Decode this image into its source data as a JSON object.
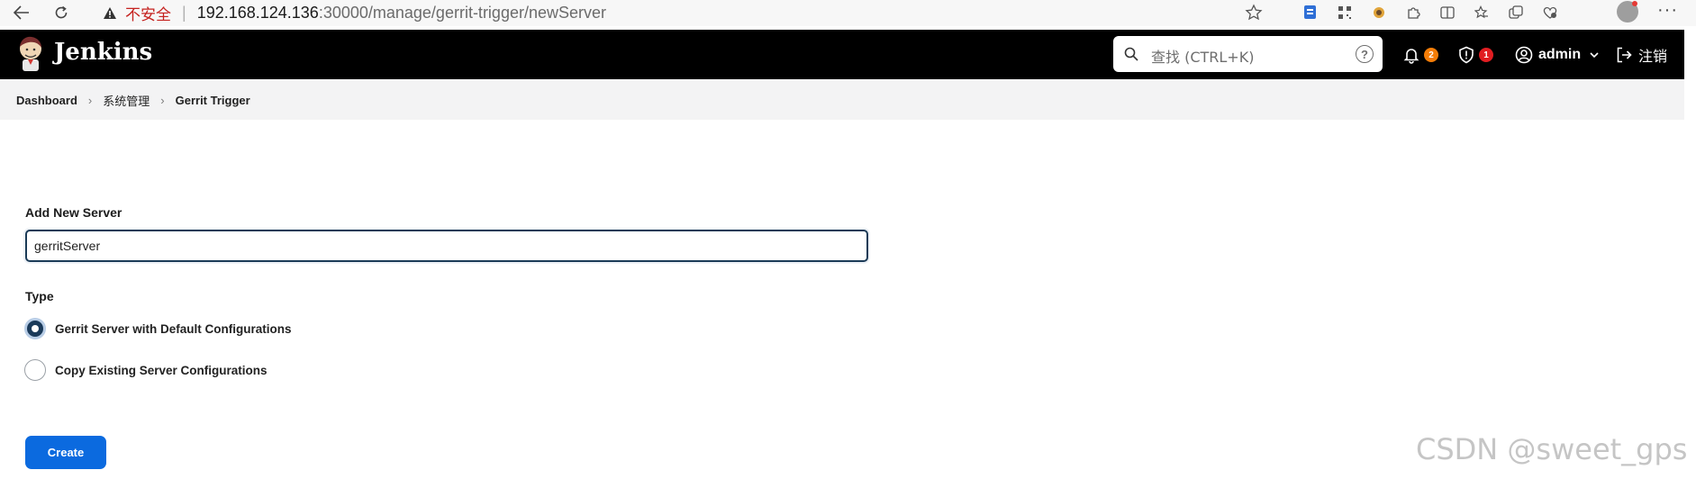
{
  "browser": {
    "insecure_label": "不安全",
    "url_host": "192.168.124.136",
    "url_path": ":30000/manage/gerrit-trigger/newServer"
  },
  "header": {
    "brand": "Jenkins",
    "search_placeholder": "查找 (CTRL+K)",
    "notifications_count": "2",
    "security_count": "1",
    "user_name": "admin",
    "logout_label": "注销",
    "badge_colors": {
      "notifications": "#f47d07",
      "security": "#e11d21"
    }
  },
  "breadcrumb": {
    "items": [
      "Dashboard",
      "系统管理",
      "Gerrit Trigger"
    ]
  },
  "form": {
    "add_label": "Add New Server",
    "server_name": "gerritServer",
    "type_label": "Type",
    "options": [
      {
        "label": "Gerrit Server with Default Configurations",
        "checked": true
      },
      {
        "label": "Copy Existing Server Configurations",
        "checked": false
      }
    ],
    "create_label": "Create"
  },
  "watermark": "CSDN @sweet_gps",
  "colors": {
    "accent": "#0b6adf",
    "header_bg": "#000000"
  }
}
